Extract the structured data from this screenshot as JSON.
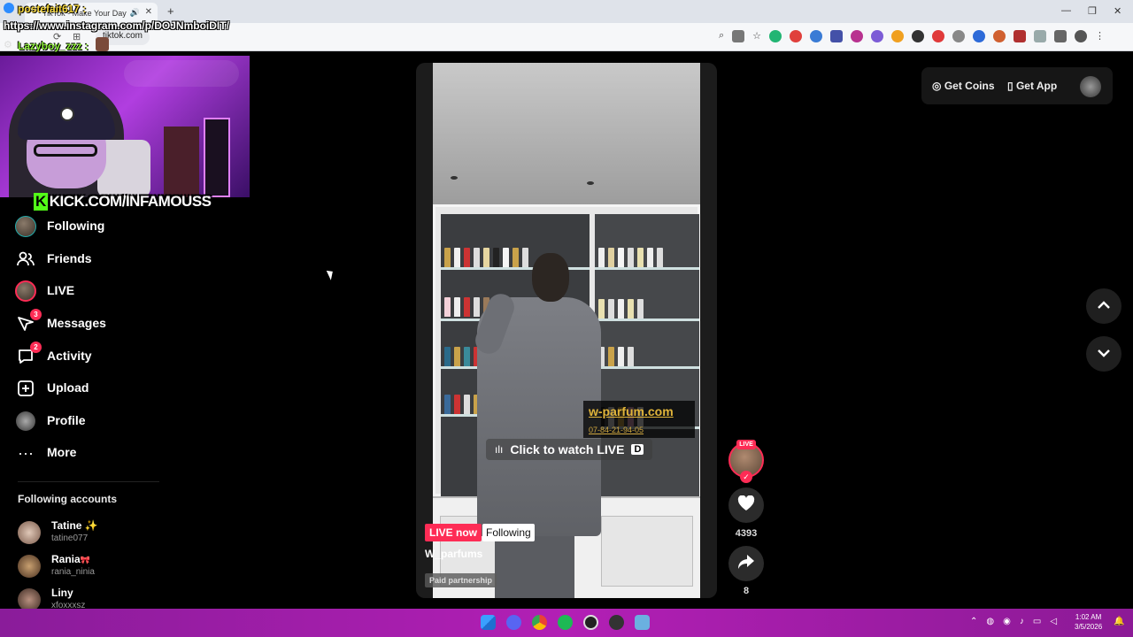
{
  "browser": {
    "tab_title": "TikTok - Make Your Day",
    "url_chip": "tiktok.com",
    "new_tab": "+"
  },
  "overlay": {
    "streamer_user": "postefait617 :",
    "shared_url": "https://www.instagram.com/p/DOJNmboiDIT/",
    "chat_user": "Lazyboy_zzz :",
    "kick_channel": "KICK.COM/INFAMOUSS"
  },
  "sidebar": {
    "items": [
      {
        "label": "Following",
        "icon": "following-avatar-icon"
      },
      {
        "label": "Friends",
        "icon": "friends-icon"
      },
      {
        "label": "LIVE",
        "icon": "live-avatar-icon"
      },
      {
        "label": "Messages",
        "icon": "messages-icon",
        "badge": "3"
      },
      {
        "label": "Activity",
        "icon": "activity-icon",
        "badge": "2"
      },
      {
        "label": "Upload",
        "icon": "upload-icon"
      },
      {
        "label": "Profile",
        "icon": "profile-avatar-icon"
      },
      {
        "label": "More",
        "icon": "more-dots-icon"
      }
    ],
    "following_accounts_title": "Following accounts",
    "accounts": [
      {
        "name": "Tatine",
        "emoji": "✨",
        "handle": "tatine077"
      },
      {
        "name": "Rania",
        "emoji": "🎀",
        "handle": "rania_ninia"
      },
      {
        "name": "Liny",
        "emoji": "",
        "handle": "xfoxxxsz"
      }
    ]
  },
  "video": {
    "overlay_brand": "w-parfum.com",
    "overlay_phone": "07-84-21-94-05",
    "watch_live": "Click to watch LIVE",
    "watch_live_key": "D",
    "live_now": "LIVE now",
    "following_tag": "Following",
    "author": "W_parfums",
    "paid_label": "Paid partnership"
  },
  "actions": {
    "live_badge": "LIVE",
    "likes": "4393",
    "shares": "8"
  },
  "top_right": {
    "get_coins": "Get Coins",
    "get_app": "Get App"
  },
  "taskbar": {
    "time": "1:02 AM",
    "date": "3/5/2026"
  },
  "colors": {
    "tiktok_red": "#fe2c55",
    "taskbar": "#b21fb5",
    "kick_green": "#53fc18"
  }
}
